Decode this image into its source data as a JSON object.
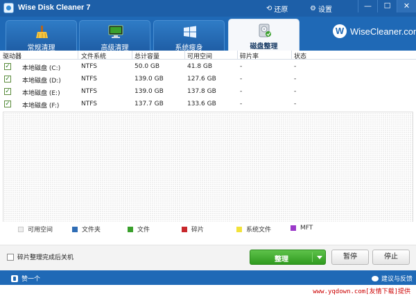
{
  "window": {
    "title": "Wise Disk Cleaner 7",
    "restore_label": "还原",
    "settings_label": "设置",
    "minimize_glyph": "—",
    "maximize_glyph": "☐",
    "close_glyph": "✕"
  },
  "tabs": [
    {
      "label": "常规清理",
      "icon": "broom-icon",
      "active": false
    },
    {
      "label": "高级清理",
      "icon": "monitor-icon",
      "active": false
    },
    {
      "label": "系统瘦身",
      "icon": "windows-icon",
      "active": false
    },
    {
      "label": "磁盘整理",
      "icon": "disk-defrag-icon",
      "active": true
    }
  ],
  "brand": {
    "logo_letter": "W",
    "name": "WiseCleaner.com"
  },
  "table": {
    "headers": [
      "驱动器",
      "文件系统",
      "总计容量",
      "可用空间",
      "碎片率",
      "状态"
    ],
    "rows": [
      {
        "checked": true,
        "drive": "本地磁盘 (C:)",
        "fs": "NTFS",
        "total": "50.0 GB",
        "free": "41.8 GB",
        "frag": "-",
        "status": "-"
      },
      {
        "checked": true,
        "drive": "本地磁盘 (D:)",
        "fs": "NTFS",
        "total": "139.0 GB",
        "free": "127.6 GB",
        "frag": "-",
        "status": "-"
      },
      {
        "checked": true,
        "drive": "本地磁盘 (E:)",
        "fs": "NTFS",
        "total": "139.0 GB",
        "free": "137.8 GB",
        "frag": "-",
        "status": "-"
      },
      {
        "checked": true,
        "drive": "本地磁盘 (F:)",
        "fs": "NTFS",
        "total": "137.7 GB",
        "free": "133.6 GB",
        "frag": "-",
        "status": "-"
      }
    ]
  },
  "legend": [
    {
      "label": "可用空间",
      "color": "#eeeeee"
    },
    {
      "label": "文件夹",
      "color": "#2f6db5"
    },
    {
      "label": "文件",
      "color": "#3aa02c"
    },
    {
      "label": "碎片",
      "color": "#c8282c"
    },
    {
      "label": "系统文件",
      "color": "#f2e23a"
    },
    {
      "label": "MFT",
      "color": "#9b39c9"
    }
  ],
  "actions": {
    "shutdown_label": "碎片整理完成后关机",
    "defrag_label": "整理",
    "pause_label": "暂停",
    "stop_label": "停止"
  },
  "statusbar": {
    "like_label": "赞一个",
    "feedback_label": "建议与反馈"
  },
  "watermark": "www.yqdown.com[友情下载]提供",
  "colors": {
    "accent": "#1f69b6",
    "primary_button": "#3aa02c"
  }
}
